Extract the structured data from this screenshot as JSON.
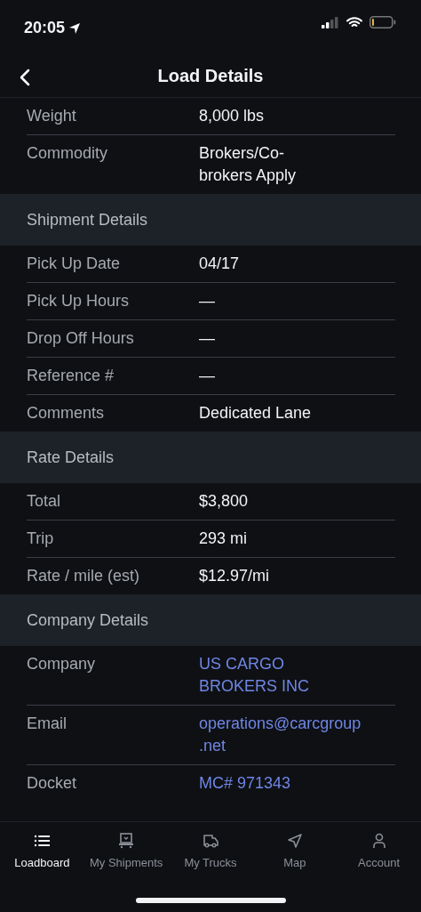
{
  "status_bar": {
    "time": "20:05"
  },
  "header": {
    "title": "Load Details"
  },
  "sections": [
    {
      "rows": [
        {
          "label": "Weight",
          "value": "8,000 lbs",
          "kind": "text"
        },
        {
          "label": "Commodity",
          "value": "Brokers/Co-\nbrokers Apply",
          "kind": "text"
        }
      ]
    },
    {
      "title": "Shipment Details",
      "rows": [
        {
          "label": "Pick Up Date",
          "value": "04/17",
          "kind": "text"
        },
        {
          "label": "Pick Up Hours",
          "value": "—",
          "kind": "text"
        },
        {
          "label": "Drop Off Hours",
          "value": "—",
          "kind": "text"
        },
        {
          "label": "Reference #",
          "value": "—",
          "kind": "text"
        },
        {
          "label": "Comments",
          "value": "Dedicated Lane",
          "kind": "text"
        }
      ]
    },
    {
      "title": "Rate Details",
      "rows": [
        {
          "label": "Total",
          "value": "$3,800",
          "kind": "text"
        },
        {
          "label": "Trip",
          "value": "293 mi",
          "kind": "text"
        },
        {
          "label": "Rate / mile (est)",
          "value": "$12.97/mi",
          "kind": "text"
        }
      ]
    },
    {
      "title": "Company Details",
      "rows": [
        {
          "label": "Company",
          "value": "US CARGO\nBROKERS INC",
          "kind": "link"
        },
        {
          "label": "Email",
          "value": "operations@carcgroup\n.net",
          "kind": "link"
        },
        {
          "label": "Docket",
          "value": "MC# 971343",
          "kind": "link"
        }
      ]
    }
  ],
  "tabs": [
    {
      "label": "Loadboard",
      "kind": "list",
      "selected": true
    },
    {
      "label": "My Shipments",
      "kind": "shipments",
      "selected": false
    },
    {
      "label": "My Trucks",
      "kind": "truck",
      "selected": false
    },
    {
      "label": "Map",
      "kind": "map",
      "selected": false
    },
    {
      "label": "Account",
      "kind": "account",
      "selected": false
    }
  ]
}
